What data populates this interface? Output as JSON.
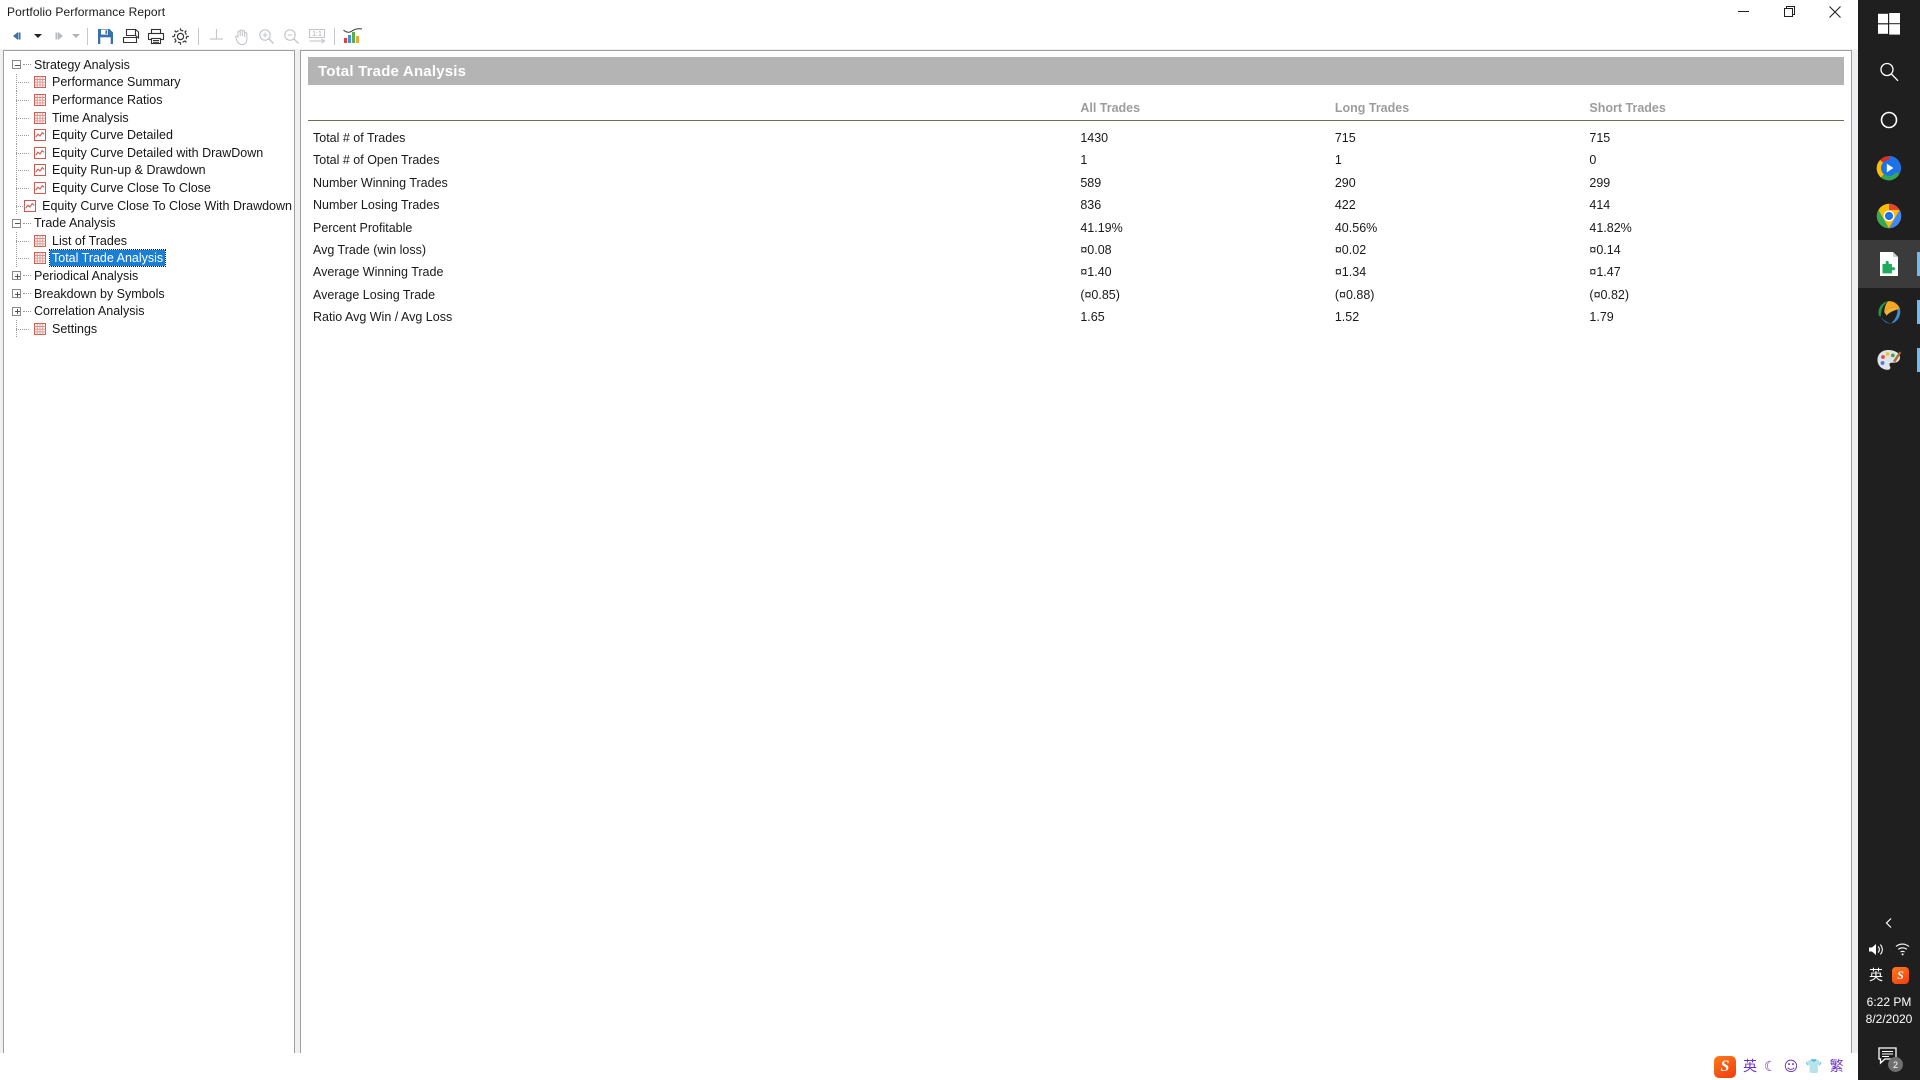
{
  "window": {
    "title": "Portfolio Performance Report",
    "buttons": [
      {
        "name": "minimize",
        "glyph": "minimize-icon"
      },
      {
        "name": "restore",
        "glyph": "restore-icon"
      },
      {
        "name": "close",
        "glyph": "close-icon"
      }
    ]
  },
  "toolbar": {
    "items": [
      {
        "name": "back-button",
        "icon": "back-arrow-icon",
        "enabled": true
      },
      {
        "name": "back-dropdown",
        "icon": "chevron-down-icon",
        "enabled": true
      },
      {
        "name": "forward-button",
        "icon": "forward-arrow-icon",
        "enabled": false
      },
      {
        "name": "forward-dropdown",
        "icon": "chevron-down-icon",
        "enabled": false
      },
      {
        "name": "save-button",
        "icon": "save-disk-icon",
        "enabled": true
      },
      {
        "name": "export-button",
        "icon": "export-document-icon",
        "enabled": true
      },
      {
        "name": "print-button",
        "icon": "printer-icon",
        "enabled": true
      },
      {
        "name": "settings-button",
        "icon": "gear-icon",
        "enabled": true
      },
      {
        "name": "page-setup-button",
        "icon": "page-setup-icon",
        "enabled": false
      },
      {
        "name": "pan-button",
        "icon": "hand-icon",
        "enabled": false
      },
      {
        "name": "zoom-in-button",
        "icon": "magnifier-plus-icon",
        "enabled": false
      },
      {
        "name": "zoom-out-button",
        "icon": "magnifier-minus-icon",
        "enabled": false
      },
      {
        "name": "actual-size-button",
        "icon": "one-to-one-icon",
        "enabled": false
      },
      {
        "name": "chart-button",
        "icon": "color-chart-icon",
        "enabled": true
      }
    ]
  },
  "tree": {
    "nodes": [
      {
        "label": "Strategy Analysis",
        "level": 0,
        "type": "group",
        "expander": "minus",
        "selected": false
      },
      {
        "label": "Performance Summary",
        "level": 1,
        "type": "grid",
        "selected": false
      },
      {
        "label": "Performance Ratios",
        "level": 1,
        "type": "grid",
        "selected": false
      },
      {
        "label": "Time Analysis",
        "level": 1,
        "type": "grid",
        "selected": false
      },
      {
        "label": "Equity Curve Detailed",
        "level": 1,
        "type": "chart",
        "selected": false
      },
      {
        "label": "Equity Curve Detailed with DrawDown",
        "level": 1,
        "type": "chart",
        "selected": false
      },
      {
        "label": "Equity Run-up & Drawdown",
        "level": 1,
        "type": "chart",
        "selected": false
      },
      {
        "label": "Equity Curve Close To Close",
        "level": 1,
        "type": "chart",
        "selected": false
      },
      {
        "label": "Equity Curve Close To Close With Drawdown",
        "level": 1,
        "type": "chart",
        "selected": false
      },
      {
        "label": "Trade Analysis",
        "level": 0,
        "type": "group",
        "expander": "minus",
        "selected": false
      },
      {
        "label": "List of Trades",
        "level": 1,
        "type": "grid",
        "selected": false
      },
      {
        "label": "Total Trade Analysis",
        "level": 1,
        "type": "grid",
        "selected": true
      },
      {
        "label": "Periodical Analysis",
        "level": 0,
        "type": "group",
        "expander": "plus",
        "selected": false
      },
      {
        "label": "Breakdown by Symbols",
        "level": 0,
        "type": "group",
        "expander": "plus",
        "selected": false
      },
      {
        "label": "Correlation Analysis",
        "level": 0,
        "type": "group",
        "expander": "plus",
        "selected": false
      },
      {
        "label": "Settings",
        "level": 1,
        "type": "grid",
        "selected": false
      }
    ]
  },
  "report": {
    "title": "Total Trade Analysis",
    "columns": [
      "",
      "All Trades",
      "Long Trades",
      "Short Trades"
    ],
    "rows": [
      {
        "label": "Total # of Trades",
        "all": "1430",
        "long": "715",
        "short": "715",
        "negative": false
      },
      {
        "label": "Total # of Open Trades",
        "all": "1",
        "long": "1",
        "short": "0",
        "negative": false
      },
      {
        "label": "Number Winning Trades",
        "all": "589",
        "long": "290",
        "short": "299",
        "negative": false
      },
      {
        "label": "Number Losing Trades",
        "all": "836",
        "long": "422",
        "short": "414",
        "negative": false
      },
      {
        "label": "Percent Profitable",
        "all": "41.19%",
        "long": "40.56%",
        "short": "41.82%",
        "negative": false
      },
      {
        "label": "Avg Trade (win  loss)",
        "all": "¤0.08",
        "long": "¤0.02",
        "short": "¤0.14",
        "negative": false
      },
      {
        "label": "Average Winning Trade",
        "all": "¤1.40",
        "long": "¤1.34",
        "short": "¤1.47",
        "negative": false
      },
      {
        "label": "Average Losing Trade",
        "all": "(¤0.85)",
        "long": "(¤0.88)",
        "short": "(¤0.82)",
        "negative": true
      },
      {
        "label": "Ratio Avg Win / Avg Loss",
        "all": "1.65",
        "long": "1.52",
        "short": "1.79",
        "negative": false
      }
    ]
  },
  "taskbar": {
    "items": [
      {
        "name": "start-button",
        "icon": "windows-logo-icon",
        "state": "normal"
      },
      {
        "name": "search-button",
        "icon": "search-icon",
        "state": "normal"
      },
      {
        "name": "task-view-button",
        "icon": "circle-icon",
        "state": "normal"
      },
      {
        "name": "media-player-button",
        "icon": "play-media-icon",
        "state": "normal"
      },
      {
        "name": "chrome-button",
        "icon": "chrome-icon",
        "state": "normal"
      },
      {
        "name": "report-app-button",
        "icon": "document-puzzle-icon",
        "state": "active"
      },
      {
        "name": "browser-app-button",
        "icon": "leaf-browser-icon",
        "state": "running"
      },
      {
        "name": "paint-button",
        "icon": "palette-icon",
        "state": "running"
      }
    ],
    "tray": {
      "chevron": "chevron-up-icon",
      "volume": "speaker-icon",
      "network": "wifi-icon",
      "ime_label": "英",
      "ime_logo": "S",
      "time": "6:22 PM",
      "date": "8/2/2020",
      "action_center_badge": "2"
    }
  },
  "ime_bar": {
    "logo": "S",
    "items": [
      "英",
      "☾",
      "☺",
      "👕",
      "繁"
    ]
  }
}
